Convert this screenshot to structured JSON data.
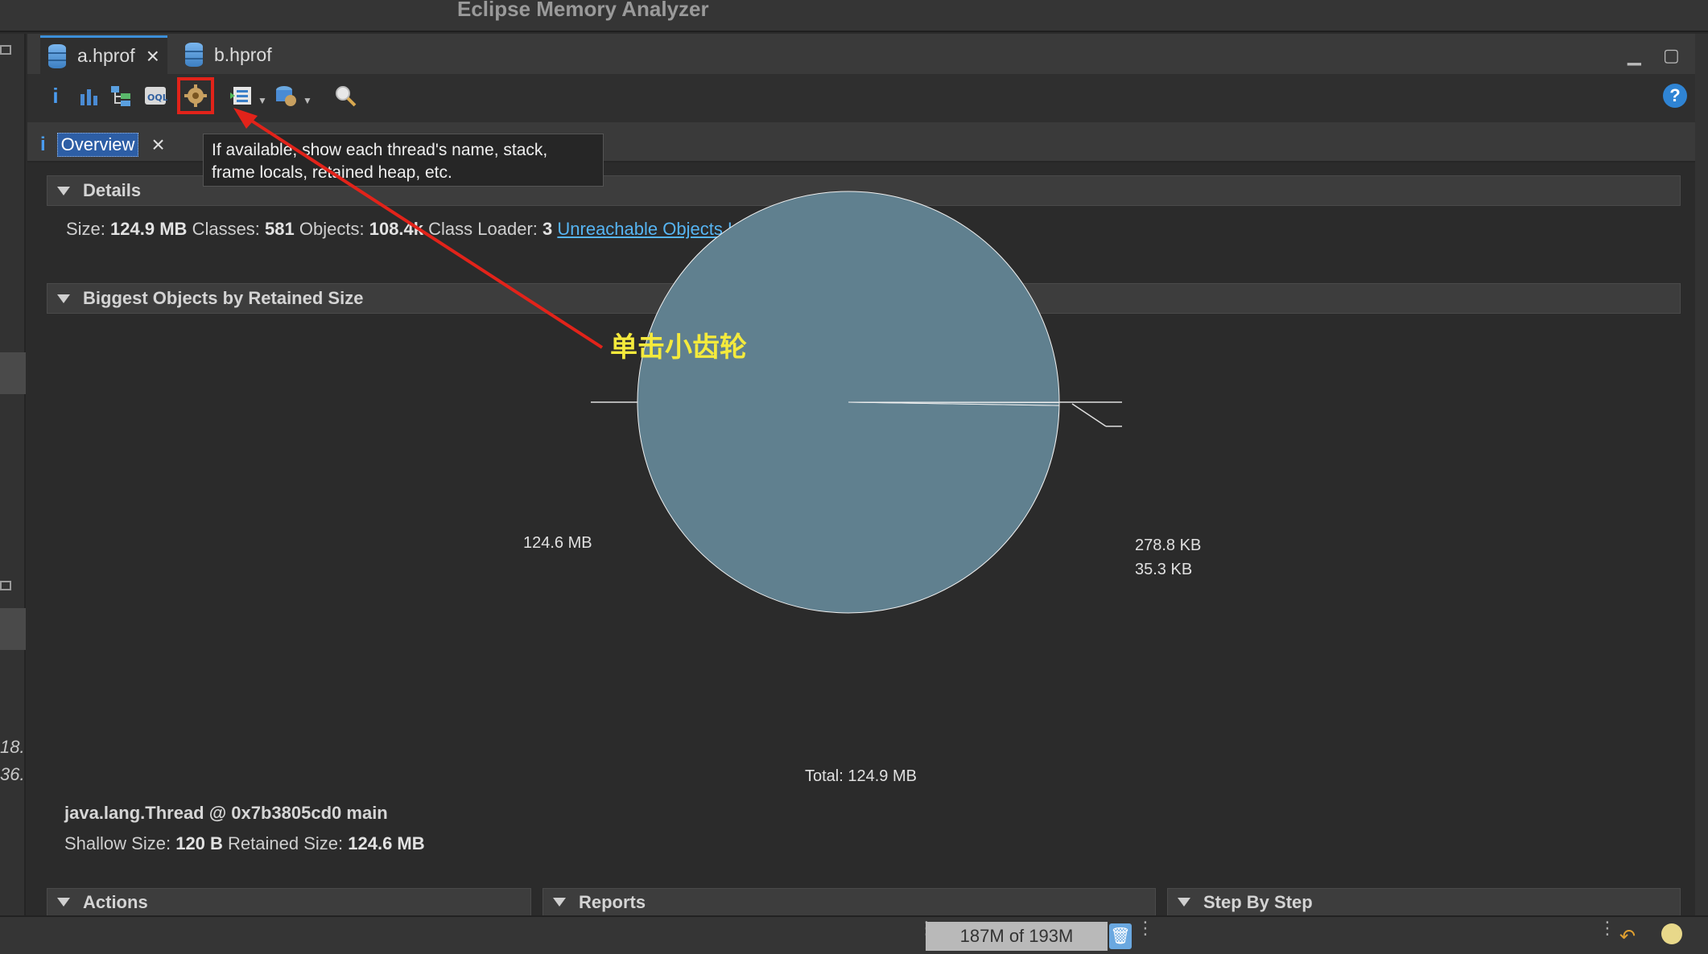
{
  "window": {
    "title": "Eclipse Memory Analyzer"
  },
  "editor_tabs": [
    {
      "label": "a.hprof",
      "active": true
    },
    {
      "label": "b.hprof",
      "active": false
    }
  ],
  "toolbar": {
    "icons": [
      "info-icon",
      "histogram-icon",
      "dominator-tree-icon",
      "oql-icon",
      "thread-overview-icon",
      "query-browser-icon",
      "heap-dump-details-icon",
      "search-icon"
    ],
    "tooltip": "If available, show each thread's name, stack, frame locals, retained heap, etc."
  },
  "sub_tab": {
    "label": "Overview"
  },
  "details": {
    "header": "Details",
    "size_label": "Size:",
    "size_value": "124.9 MB",
    "classes_label": "Classes:",
    "classes_value": "581",
    "objects_label": "Objects:",
    "objects_value": "108.4k",
    "loader_label": "Class Loader:",
    "loader_value": "3",
    "link": "Unreachable Objects Histogram"
  },
  "biggest_objects": {
    "header": "Biggest Objects by Retained Size",
    "object_name": "java.lang.Thread @ 0x7b3805cd0 main",
    "shallow_label": "Shallow Size:",
    "shallow_value": "120 B",
    "retained_label": "Retained Size:",
    "retained_value": "124.6 MB"
  },
  "chart_data": {
    "type": "pie",
    "slices": [
      {
        "label": "124.6 MB",
        "value": 124.6
      },
      {
        "label": "278.8 KB",
        "value": 0.2788
      },
      {
        "label": "35.3 KB",
        "value": 0.0353
      }
    ],
    "total_label": "Total: 124.9 MB",
    "colors": [
      "#60808f",
      "#60808f",
      "#60808f"
    ]
  },
  "annotation": "单击小齿轮",
  "bottom_sections": [
    "Actions",
    "Reports",
    "Step By Step"
  ],
  "status": {
    "memory": "187M of 193M"
  },
  "left_strip_numbers": [
    "18.",
    "36."
  ],
  "colors": {
    "accent": "#3c8fd8",
    "highlight": "#e2231a",
    "annotation": "#f4ea3c",
    "link": "#56b4f2"
  }
}
